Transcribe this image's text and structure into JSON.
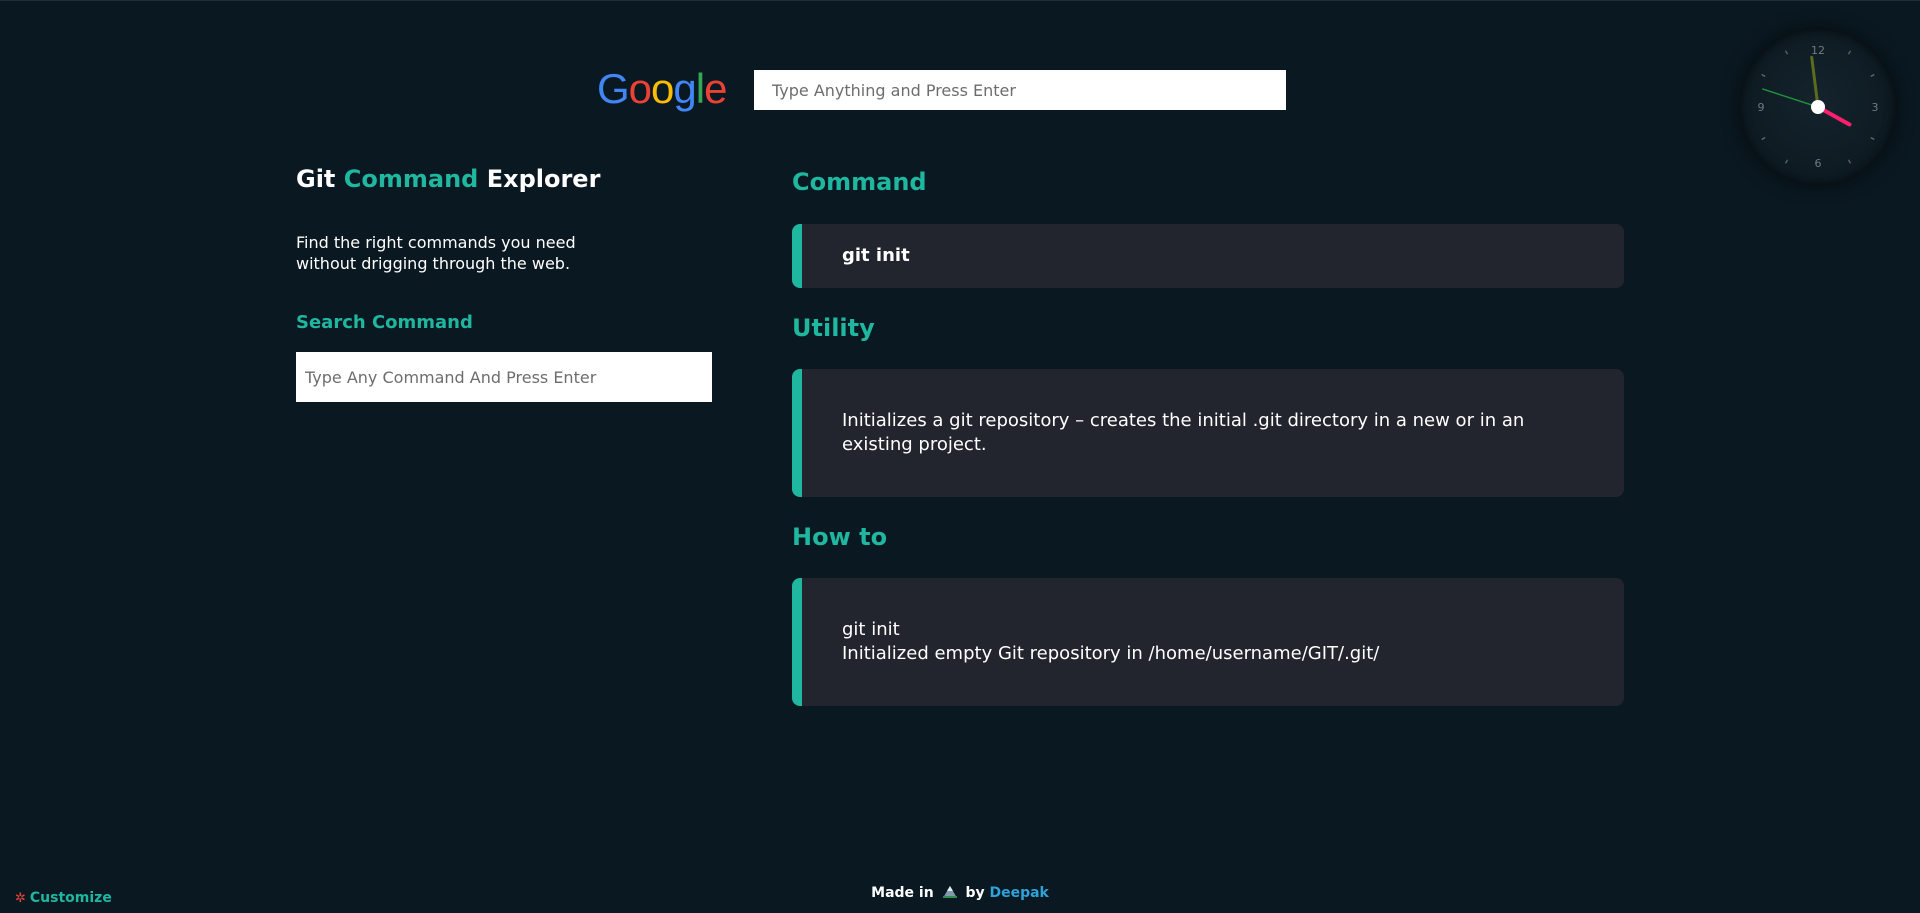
{
  "google": {
    "logo_letters": [
      "G",
      "o",
      "o",
      "g",
      "l",
      "e"
    ],
    "logo_colors": [
      "#4285f4",
      "#ea4335",
      "#fbbc05",
      "#4285f4",
      "#34a853",
      "#ea4335"
    ],
    "search_placeholder": "Type Anything and Press Enter"
  },
  "clock": {
    "numerals": [
      "12",
      "3",
      "6",
      "9"
    ],
    "time": {
      "hours": 3,
      "minutes": 58,
      "seconds": 48
    },
    "hand_colors": {
      "hour": "#ff1f6e",
      "minute": "#5d6b1e",
      "second": "#1f8f3a"
    }
  },
  "left": {
    "title_part1": "Git",
    "title_accent": "Command",
    "title_part2": "Explorer",
    "description": "Find the right commands you need without drigging through the web.",
    "search_label": "Search Command",
    "search_placeholder": "Type Any Command And Press Enter"
  },
  "result": {
    "command_title": "Command",
    "command_value": "git init",
    "utility_title": "Utility",
    "utility_value": "Initializes a git repository – creates the initial .git directory in a new or in an existing project.",
    "howto_title": "How to",
    "howto_line1": "git init",
    "howto_line2": "Initialized empty Git repository in /home/username/GIT/.git/"
  },
  "footer": {
    "customize_label": "Customize",
    "made_in": "Made in",
    "by": "by",
    "author": "Deepak"
  },
  "colors": {
    "background": "#0a1821",
    "accent": "#1fb7a0",
    "card": "#22242e",
    "author_link": "#2ea3d9"
  }
}
